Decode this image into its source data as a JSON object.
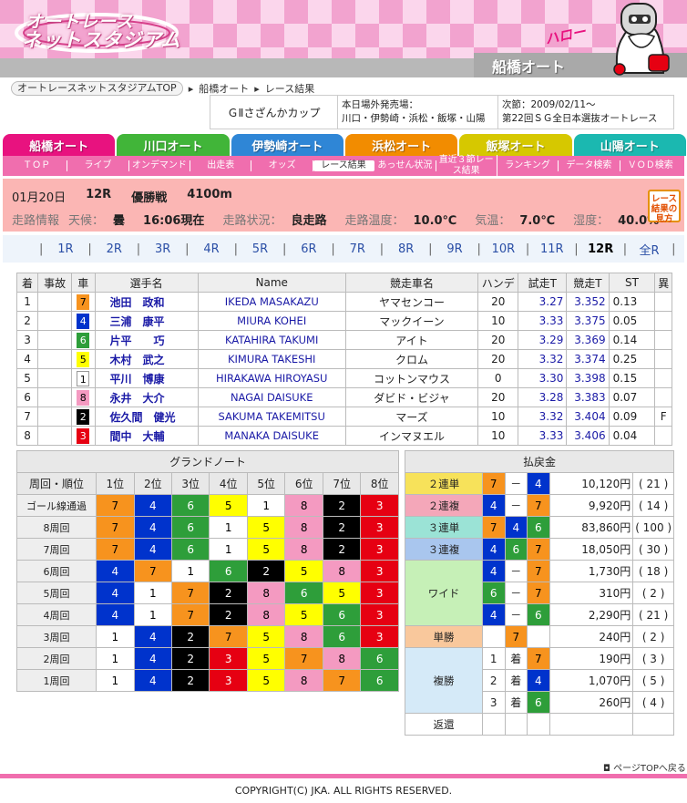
{
  "header": {
    "site_title_1": "オートレース",
    "site_title_2": "ネットスタジアム",
    "hello": "ハロー",
    "venue": "船橋オート"
  },
  "breadcrumb": {
    "home": "オートレースネットスタジアムTOP",
    "venue": "船橋オート",
    "page": "レース結果"
  },
  "info": {
    "race_title": "ＧⅡさざんかカップ",
    "offtrack_label": "本日場外発売場：",
    "offtrack_venues": "川口・伊勢崎・浜松・飯塚・山陽",
    "next_label": "次節：2009/02/11～",
    "next_event": "第22回ＳＧ全日本選抜オートレース"
  },
  "tabs": [
    {
      "label": "船橋オート",
      "color": "#e8127f"
    },
    {
      "label": "川口オート",
      "color": "#41b539"
    },
    {
      "label": "伊勢崎オート",
      "color": "#2f86d6"
    },
    {
      "label": "浜松オート",
      "color": "#f28c00"
    },
    {
      "label": "飯塚オート",
      "color": "#d6c800"
    },
    {
      "label": "山陽オート",
      "color": "#1bb8b0"
    }
  ],
  "subnav": [
    "ＴＯＰ",
    "ライブ",
    "オンデマンド",
    "出走表",
    "オッズ",
    "レース結果",
    "あっせん状況",
    "直近３節レース結果",
    "ランキング",
    "データ検索",
    "ＶＯＤ検索"
  ],
  "race": {
    "date": "01月20日",
    "number": "12R",
    "type": "優勝戦",
    "distance": "4100m",
    "cond_label": "走路情報",
    "weather_label": "天候：",
    "weather": "曇",
    "time": "16:06現在",
    "track_label": "走路状況：",
    "track": "良走路",
    "track_temp_label": "走路温度：",
    "track_temp": "10.0℃",
    "air_temp_label": "気温：",
    "air_temp": "7.0℃",
    "humidity_label": "湿度：",
    "humidity": "40.0%",
    "guide": "レース結果の見方"
  },
  "race_nav": [
    "1R",
    "2R",
    "3R",
    "4R",
    "5R",
    "6R",
    "7R",
    "8R",
    "9R",
    "10R",
    "11R",
    "12R",
    "全R"
  ],
  "results": {
    "headers": [
      "着",
      "事故",
      "車",
      "選手名",
      "Name",
      "競走車名",
      "ハンデ",
      "試走T",
      "競走T",
      "ST",
      "異"
    ],
    "rows": [
      {
        "pos": "1",
        "acc": "",
        "car": "7",
        "name": "池田　政和",
        "en": "IKEDA MASAKAZU",
        "machine": "ヤマセンコー",
        "hande": "20",
        "trial": "3.27",
        "race_t": "3.352",
        "st": "0.13",
        "abn": ""
      },
      {
        "pos": "2",
        "acc": "",
        "car": "4",
        "name": "三浦　康平",
        "en": "MIURA KOHEI",
        "machine": "マックイーン",
        "hande": "10",
        "trial": "3.33",
        "race_t": "3.375",
        "st": "0.05",
        "abn": ""
      },
      {
        "pos": "3",
        "acc": "",
        "car": "6",
        "name": "片平　　巧",
        "en": "KATAHIRA TAKUMI",
        "machine": "アイト",
        "hande": "20",
        "trial": "3.29",
        "race_t": "3.369",
        "st": "0.14",
        "abn": ""
      },
      {
        "pos": "4",
        "acc": "",
        "car": "5",
        "name": "木村　武之",
        "en": "KIMURA TAKESHI",
        "machine": "クロム",
        "hande": "20",
        "trial": "3.32",
        "race_t": "3.374",
        "st": "0.25",
        "abn": ""
      },
      {
        "pos": "5",
        "acc": "",
        "car": "1",
        "name": "平川　博康",
        "en": "HIRAKAWA HIROYASU",
        "machine": "コットンマウス",
        "hande": "0",
        "trial": "3.30",
        "race_t": "3.398",
        "st": "0.15",
        "abn": ""
      },
      {
        "pos": "6",
        "acc": "",
        "car": "8",
        "name": "永井　大介",
        "en": "NAGAI DAISUKE",
        "machine": "ダビド・ビジャ",
        "hande": "20",
        "trial": "3.28",
        "race_t": "3.383",
        "st": "0.07",
        "abn": ""
      },
      {
        "pos": "7",
        "acc": "",
        "car": "2",
        "name": "佐久間　健光",
        "en": "SAKUMA TAKEMITSU",
        "machine": "マーズ",
        "hande": "10",
        "trial": "3.32",
        "race_t": "3.404",
        "st": "0.09",
        "abn": "F"
      },
      {
        "pos": "8",
        "acc": "",
        "car": "3",
        "name": "間中　大輔",
        "en": "MANAKA DAISUKE",
        "machine": "インマヌエル",
        "hande": "10",
        "trial": "3.33",
        "race_t": "3.406",
        "st": "0.04",
        "abn": ""
      }
    ]
  },
  "car_colors": {
    "1": {
      "bg": "#ffffff",
      "fg": "#000000"
    },
    "2": {
      "bg": "#000000",
      "fg": "#ffffff"
    },
    "3": {
      "bg": "#e60012",
      "fg": "#ffffff"
    },
    "4": {
      "bg": "#0033cc",
      "fg": "#ffffff"
    },
    "5": {
      "bg": "#ffff00",
      "fg": "#000000"
    },
    "6": {
      "bg": "#2e9e3a",
      "fg": "#ffffff"
    },
    "7": {
      "bg": "#f7931e",
      "fg": "#000000"
    },
    "8": {
      "bg": "#f49ac1",
      "fg": "#000000"
    }
  },
  "grand_note": {
    "title": "グランドノート",
    "headers": [
      "周回・順位",
      "1位",
      "2位",
      "3位",
      "4位",
      "5位",
      "6位",
      "7位",
      "8位"
    ],
    "rows": [
      {
        "label": "ゴール線通過",
        "cars": [
          "7",
          "4",
          "6",
          "5",
          "1",
          "8",
          "2",
          "3"
        ]
      },
      {
        "label": "8周回",
        "cars": [
          "7",
          "4",
          "6",
          "1",
          "5",
          "8",
          "2",
          "3"
        ]
      },
      {
        "label": "7周回",
        "cars": [
          "7",
          "4",
          "6",
          "1",
          "5",
          "8",
          "2",
          "3"
        ]
      },
      {
        "label": "6周回",
        "cars": [
          "4",
          "7",
          "1",
          "6",
          "2",
          "5",
          "8",
          "3"
        ]
      },
      {
        "label": "5周回",
        "cars": [
          "4",
          "1",
          "7",
          "2",
          "8",
          "6",
          "5",
          "3"
        ]
      },
      {
        "label": "4周回",
        "cars": [
          "4",
          "1",
          "7",
          "2",
          "8",
          "5",
          "6",
          "3"
        ]
      },
      {
        "label": "3周回",
        "cars": [
          "1",
          "4",
          "2",
          "7",
          "5",
          "8",
          "6",
          "3"
        ]
      },
      {
        "label": "2周回",
        "cars": [
          "1",
          "4",
          "2",
          "3",
          "5",
          "7",
          "8",
          "6"
        ]
      },
      {
        "label": "1周回",
        "cars": [
          "1",
          "4",
          "2",
          "3",
          "5",
          "8",
          "7",
          "6"
        ]
      }
    ]
  },
  "payout": {
    "title": "払戻金",
    "type_colors": {
      "exacta": "#f7e25a",
      "quinella": "#f4a7b9",
      "trifecta": "#9be3d6",
      "trio": "#a9c6ee",
      "wide": "#c6f0b7",
      "win": "#f9c89c",
      "place": "#d5eaf8",
      "refund": "#ffffff"
    },
    "rows": [
      {
        "type": "２連単",
        "key": "exacta",
        "rows": 1,
        "combo": [
          "7",
          "－",
          "4"
        ],
        "amount": "10,120円",
        "pop": "( 21 )"
      },
      {
        "type": "２連複",
        "key": "quinella",
        "rows": 1,
        "combo": [
          "4",
          "－",
          "7"
        ],
        "amount": "9,920円",
        "pop": "( 14 )"
      },
      {
        "type": "３連単",
        "key": "trifecta",
        "rows": 1,
        "combo": [
          "7",
          "4",
          "6"
        ],
        "amount": "83,860円",
        "pop": "( 100 )"
      },
      {
        "type": "３連複",
        "key": "trio",
        "rows": 1,
        "combo": [
          "4",
          "6",
          "7"
        ],
        "amount": "18,050円",
        "pop": "( 30 )"
      },
      {
        "type": "ワイド",
        "key": "wide",
        "rows": 3,
        "combo": [
          "4",
          "－",
          "7"
        ],
        "amount": "1,730円",
        "pop": "( 18 )"
      },
      {
        "type": "",
        "key": "wide",
        "rows": 0,
        "combo": [
          "6",
          "－",
          "7"
        ],
        "amount": "310円",
        "pop": "( 2 )"
      },
      {
        "type": "",
        "key": "wide",
        "rows": 0,
        "combo": [
          "4",
          "－",
          "6"
        ],
        "amount": "2,290円",
        "pop": "( 21 )"
      },
      {
        "type": "単勝",
        "key": "win",
        "rows": 1,
        "combo": [
          "",
          "7",
          ""
        ],
        "amount": "240円",
        "pop": "( 2 )"
      },
      {
        "type": "複勝",
        "key": "place",
        "rows": 3,
        "combo": [
          "1",
          "着",
          "7"
        ],
        "amount": "190円",
        "pop": "( 3 )"
      },
      {
        "type": "",
        "key": "place",
        "rows": 0,
        "combo": [
          "2",
          "着",
          "4"
        ],
        "amount": "1,070円",
        "pop": "( 5 )"
      },
      {
        "type": "",
        "key": "place",
        "rows": 0,
        "combo": [
          "3",
          "着",
          "6"
        ],
        "amount": "260円",
        "pop": "( 4 )"
      },
      {
        "type": "返還",
        "key": "refund",
        "rows": 1,
        "combo": [
          "",
          "",
          ""
        ],
        "amount": "",
        "pop": ""
      }
    ]
  },
  "footer": {
    "page_top": "ページTOPへ戻る",
    "copyright": "COPYRIGHT(C) JKA. ALL RIGHTS RESERVED."
  }
}
